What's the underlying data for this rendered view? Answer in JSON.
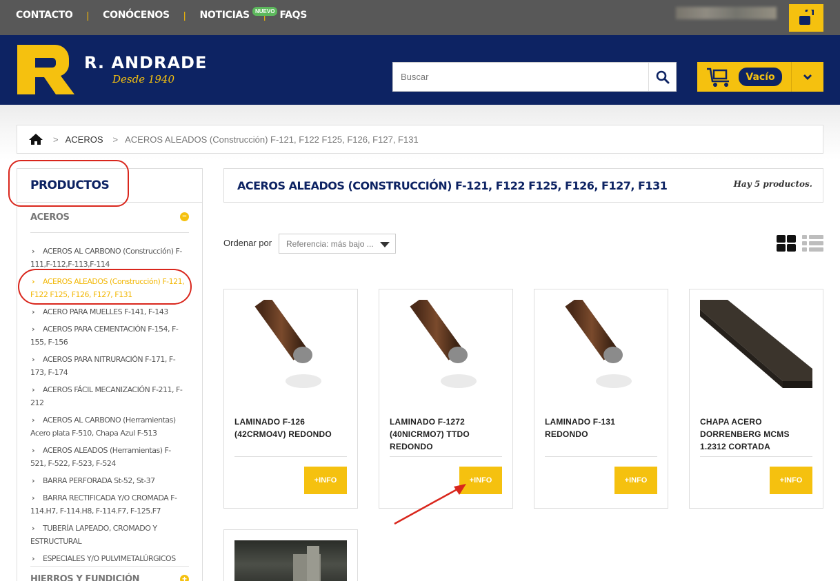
{
  "topbar": {
    "nav": [
      "CONTACTO",
      "CONÓCENOS",
      "NOTICIAS",
      "FAQS"
    ],
    "separator": "|",
    "faq_badge": "NUEVO"
  },
  "header": {
    "brand_name": "R. ANDRADE",
    "brand_tagline": "Desde 1940",
    "search_placeholder": "Buscar",
    "cart_status": "Vacío"
  },
  "breadcrumb": {
    "separator": ">",
    "items": [
      "ACEROS",
      "ACEROS ALEADOS (Construcción) F-121, F122 F125, F126, F127, F131"
    ]
  },
  "sidebar": {
    "title": "PRODUCTOS",
    "category": "ACEROS",
    "category_toggle": "−",
    "subcategories": [
      "ACEROS AL CARBONO (Construcción) F-111,F-112,F-113,F-114",
      "ACEROS ALEADOS (Construcción) F-121, F122 F125, F126, F127, F131",
      "ACERO PARA MUELLES F-141, F-143",
      "ACEROS PARA CEMENTACIÓN F-154, F-155, F-156",
      "ACEROS PARA NITRURACIÓN F-171, F-173, F-174",
      "ACEROS FÁCIL MECANIZACIÓN F-211, F-212",
      "ACEROS AL CARBONO (Herramientas) Acero plata F-510, Chapa Azul F-513",
      "ACEROS ALEADOS (Herramientas) F-521, F-522, F-523, F-524",
      "BARRA PERFORADA St-52, St-37",
      "BARRA RECTIFICADA Y/O CROMADA F-114.H7, F-114.H8, F-114.F7, F-125.F7",
      "TUBERÍA LAPEADO, CROMADO Y ESTRUCTURAL",
      "ESPECIALES Y/O PULVIMETALÚRGICOS"
    ],
    "next_category": "HIERROS Y FUNDICIÓN",
    "next_toggle": "+"
  },
  "main": {
    "title": "ACEROS ALEADOS (CONSTRUCCIÓN) F-121, F122 F125, F126, F127, F131",
    "product_count": "Hay 5 productos.",
    "sort_label": "Ordenar por",
    "sort_value": "Referencia: más bajo ..."
  },
  "products": [
    {
      "name": "LAMINADO F-126 (42CRMO4V) REDONDO",
      "button": "+INFO"
    },
    {
      "name": "LAMINADO F-1272 (40NICRMO7) TTDO REDONDO",
      "button": "+INFO"
    },
    {
      "name": "LAMINADO F-131 REDONDO",
      "button": "+INFO"
    },
    {
      "name": "CHAPA ACERO DORRENBERG MCMS 1.2312 CORTADA",
      "button": "+INFO"
    }
  ],
  "colors": {
    "navy": "#0d2363",
    "accent_yellow": "#f5c10f",
    "annotation_red": "#d9261c"
  }
}
